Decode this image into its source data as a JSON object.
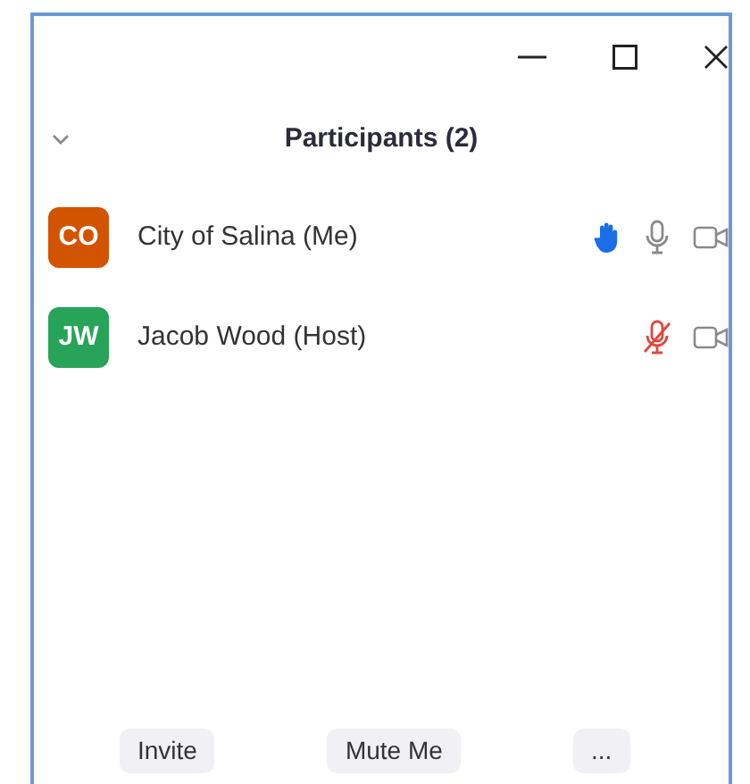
{
  "panel": {
    "title": "Participants (2)"
  },
  "participants": [
    {
      "initials": "CO",
      "name": "City of Salina (Me)",
      "color": "#d35400",
      "hand_raised": true,
      "muted": false
    },
    {
      "initials": "JW",
      "name": "Jacob Wood (Host)",
      "color": "#27a35a",
      "hand_raised": false,
      "muted": true
    }
  ],
  "buttons": [
    {
      "label": "Invite"
    },
    {
      "label": "Mute Me"
    },
    {
      "label": "..."
    }
  ]
}
